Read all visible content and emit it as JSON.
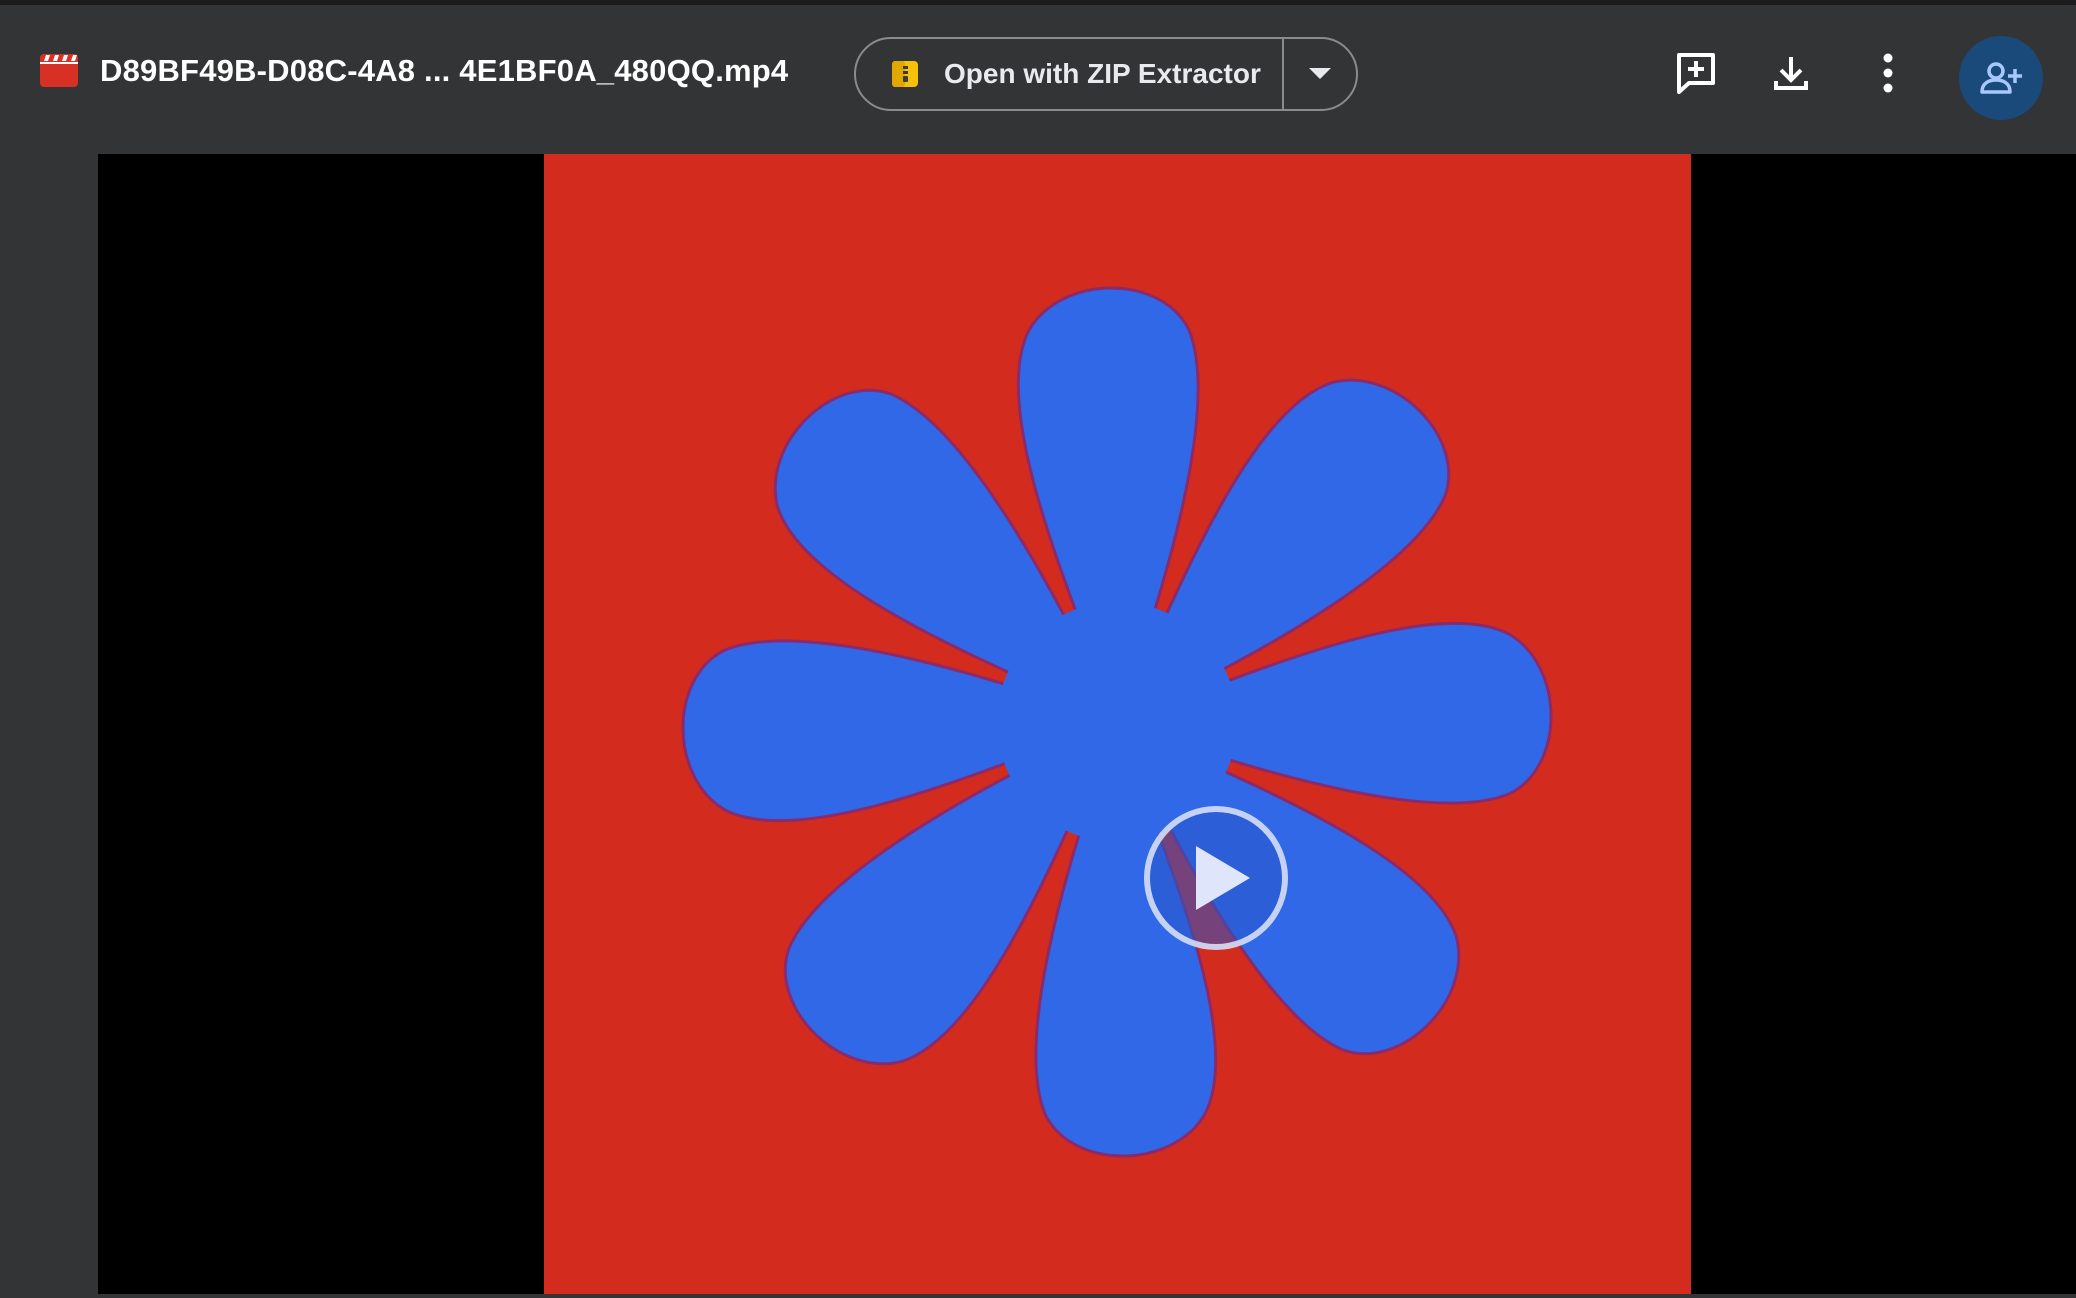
{
  "header": {
    "file_icon": "video-file-icon",
    "file_name": "D89BF49B-D08C-4A8 ... 4E1BF0A_480QQ.mp4",
    "open_with": {
      "icon": "zip-extractor-icon",
      "label": "Open with ZIP Extractor",
      "dropdown_icon": "caret-down-icon"
    },
    "actions": [
      {
        "name": "add-comment",
        "icon": "add-comment-icon"
      },
      {
        "name": "download",
        "icon": "download-icon"
      },
      {
        "name": "more-options",
        "icon": "more-vert-icon"
      },
      {
        "name": "share",
        "icon": "person-add-icon"
      }
    ]
  },
  "player": {
    "play_icon": "play-icon"
  },
  "colors": {
    "background": "#333435",
    "video_frame_red": "#d42b1f",
    "flower_blue": "#3068e8",
    "share_button": "#1a4a7a",
    "letterbox": "#000000"
  }
}
